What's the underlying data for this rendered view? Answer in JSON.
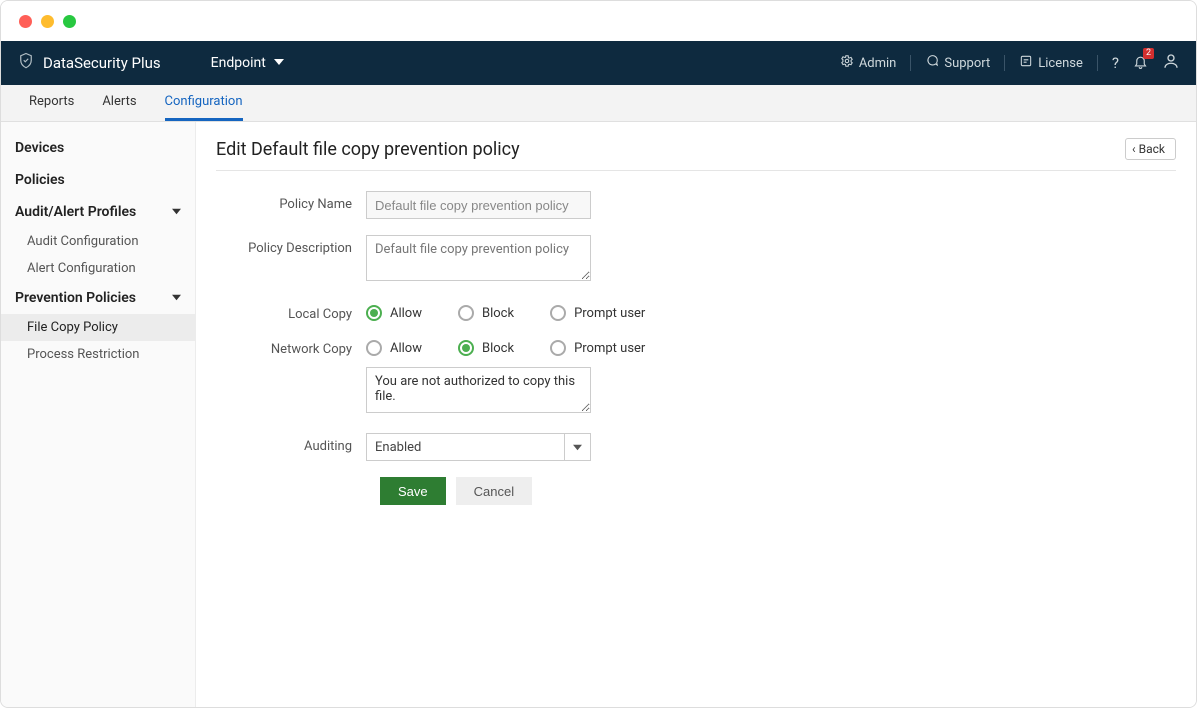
{
  "brand": "DataSecurity Plus",
  "module": "Endpoint",
  "topright": {
    "admin": "Admin",
    "support": "Support",
    "license": "License",
    "badge": "2"
  },
  "tabs": [
    "Reports",
    "Alerts",
    "Configuration"
  ],
  "activeTab": "Configuration",
  "sidebar": {
    "devices": "Devices",
    "policies": "Policies",
    "audit_profiles": "Audit/Alert Profiles",
    "audit_config": "Audit Configuration",
    "alert_config": "Alert Configuration",
    "prevention_policies": "Prevention Policies",
    "file_copy_policy": "File Copy Policy",
    "process_restriction": "Process Restriction"
  },
  "page": {
    "title": "Edit Default file copy prevention policy",
    "back": "Back"
  },
  "form": {
    "labels": {
      "policy_name": "Policy Name",
      "policy_description": "Policy Description",
      "local_copy": "Local Copy",
      "network_copy": "Network Copy",
      "auditing": "Auditing"
    },
    "policy_name": "Default file copy prevention policy",
    "policy_description": "Default file copy prevention policy",
    "options": {
      "allow": "Allow",
      "block": "Block",
      "prompt": "Prompt user"
    },
    "local_copy_selected": "allow",
    "network_copy_selected": "block",
    "block_message": "You are not authorized to copy this file.",
    "auditing": "Enabled",
    "save": "Save",
    "cancel": "Cancel"
  }
}
